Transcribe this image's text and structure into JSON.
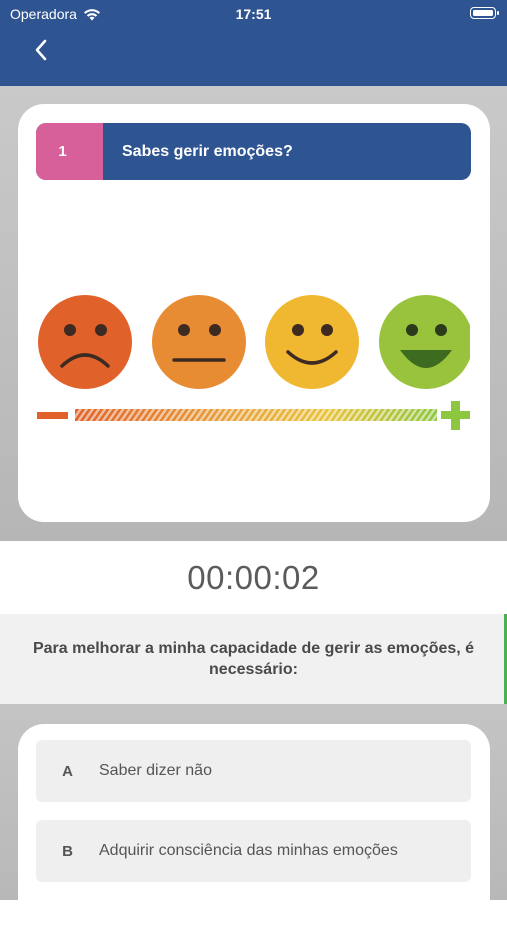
{
  "status_bar": {
    "carrier": "Operadora",
    "time": "17:51"
  },
  "question": {
    "number": "1",
    "title": "Sabes gerir emoções?"
  },
  "scale": {
    "faces": [
      "very-sad-face-icon",
      "neutral-face-icon",
      "smiling-face-icon",
      "laughing-face-icon"
    ],
    "colors": [
      "#e0622a",
      "#e88c33",
      "#f0b731",
      "#99c33d"
    ],
    "minus_color": "#e0622a",
    "plus_color": "#8dc63f"
  },
  "timer": "00:00:02",
  "prompt": "Para melhorar a minha capacidade de gerir as emoções, é necessário:",
  "options": [
    {
      "letter": "A",
      "text": "Saber dizer não"
    },
    {
      "letter": "B",
      "text": "Adquirir consciência das minhas emoções"
    }
  ]
}
